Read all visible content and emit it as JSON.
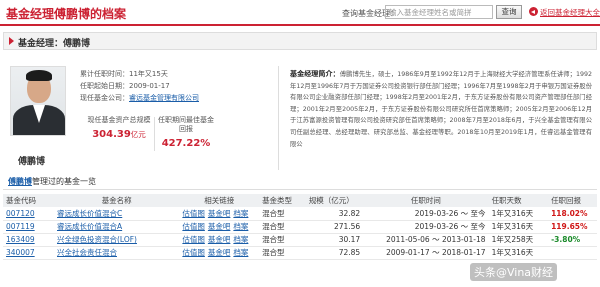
{
  "header": {
    "title": "基金经理傅鹏博的档案",
    "query_label": "查询基金经理：",
    "query_placeholder": "输入基金经理姓名或简拼",
    "query_button": "查询",
    "back_link": "返回基金经理大全"
  },
  "section": {
    "title": "基金经理：傅鹏博"
  },
  "profile": {
    "name": "傅鹏博",
    "tenure": "累计任职时间：11年又15天",
    "start_date": "任职起始日期：2009-01-17",
    "company_label": "现任基金公司：",
    "company": "睿远基金管理有限公司",
    "aum_label": "现任基金资产总规模",
    "aum_value": "304.39",
    "aum_unit": "亿元",
    "best_label": "任职期间最佳基金回报",
    "best_value": "427.22%"
  },
  "bio": {
    "label": "基金经理简介：",
    "text": "傅鹏博先生，硕士，1986年9月至1992年12月于上海财经大学经济管理系任讲师；1992年12月至1996年7月于万国证券公司投资银行部任部门经理；1996年7月至1998年2月于申银万国证券股份有限公司企业融资部任部门经理；1998年2月至2001年2月，于东方证券股份有限公司资产管理部任部门经理；2001年2月至2005年2月，于东方证券股份有限公司研究所任首席策略师；2005年2月至2006年12月于江苏富源投资管理有限公司投资研究部任首席策略师；2008年7月至2018年6月，于兴全基金管理有限公司任副总经理、总经理助理、研究部总监、基金经理等职。2018年10月至2019年1月，任睿远基金管理有限公"
  },
  "fund_list": {
    "manager_link": "傅鹏博",
    "title_suffix": "管理过的基金一览",
    "headers": [
      "基金代码",
      "基金名称",
      "相关链接",
      "基金类型",
      "规模（亿元）",
      "任职时间",
      "任职天数",
      "任职回报"
    ],
    "rows": [
      {
        "code": "007120",
        "name": "睿远成长价值混合C",
        "links": [
          "估值图",
          "基金吧",
          "档案"
        ],
        "type": "混合型",
        "size": "32.82",
        "period": "2019-03-26 ～ 至今",
        "days": "1年又316天",
        "ret": "118.02%",
        "ret_color": "red"
      },
      {
        "code": "007119",
        "name": "睿远成长价值混合A",
        "links": [
          "估值图",
          "基金吧",
          "档案"
        ],
        "type": "混合型",
        "size": "271.56",
        "period": "2019-03-26 ～ 至今",
        "days": "1年又316天",
        "ret": "119.65%",
        "ret_color": "red"
      },
      {
        "code": "163409",
        "name": "兴全绿色投资混合(LOF)",
        "links": [
          "估值图",
          "基金吧",
          "档案"
        ],
        "type": "混合型",
        "size": "30.17",
        "period": "2011-05-06 ～ 2013-01-18",
        "days": "1年又258天",
        "ret": "-3.80%",
        "ret_color": "green"
      },
      {
        "code": "340007",
        "name": "兴全社会责任混合",
        "links": [
          "估值图",
          "基金吧",
          "档案"
        ],
        "type": "混合型",
        "size": "72.85",
        "period": "2009-01-17 ～ 2018-01-17",
        "days": "1年又316天",
        "ret": "",
        "ret_color": "red"
      }
    ]
  },
  "watermark": "头条@Vina财经"
}
